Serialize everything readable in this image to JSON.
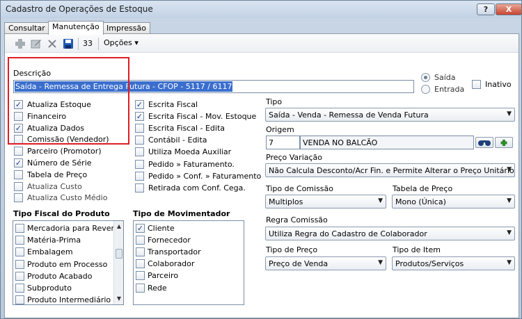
{
  "window": {
    "title": "Cadastro de Operações de Estoque",
    "help": "?",
    "close": "X"
  },
  "tabs": [
    "Consultar",
    "Manutenção",
    "Impressão"
  ],
  "toolbar": {
    "count": "33",
    "options": "Opções ▾"
  },
  "descricao": {
    "label": "Descrição",
    "value": "Saída - Remessa de Entrega Futura - CFOP - 5117 / 6117"
  },
  "direction": {
    "options": [
      "Saída",
      "Entrada"
    ],
    "selected": "Saída"
  },
  "inativo": {
    "label": "Inativo",
    "checked": false
  },
  "flags_col1": [
    {
      "label": "Atualiza  Estoque",
      "checked": true
    },
    {
      "label": "Financeiro",
      "checked": false
    },
    {
      "label": "Atualiza Dados",
      "checked": true
    },
    {
      "label": "Comissão (Vendedor)",
      "checked": false
    },
    {
      "label": "Parceiro (Promotor)",
      "checked": false
    },
    {
      "label": "Número de Série",
      "checked": true
    },
    {
      "label": "Tabela de Preço",
      "checked": false
    },
    {
      "label": "Atualiza Custo",
      "checked": false
    },
    {
      "label": "Atualiza Custo Médio",
      "checked": false
    }
  ],
  "flags_col2": [
    {
      "label": "Escrita Fiscal",
      "checked": true
    },
    {
      "label": "Escrita Fiscal - Mov. Estoque",
      "checked": true
    },
    {
      "label": "Escrita Fiscal - Edita",
      "checked": false
    },
    {
      "label": "Contábil - Edita",
      "checked": false
    },
    {
      "label": "Utiliza Moeda Auxiliar",
      "checked": false
    },
    {
      "label": "Pedido » Faturamento.",
      "checked": false
    },
    {
      "label": "Pedido » Conf. » Faturamento",
      "checked": false
    },
    {
      "label": "Retirada com Conf. Cega.",
      "checked": false
    }
  ],
  "tipo_fiscal": {
    "title": "Tipo Fiscal do Produto",
    "items": [
      "Mercadoria para Reven",
      "Matéria-Prima",
      "Embalagem",
      "Produto em Processo",
      "Produto Acabado",
      "Subproduto",
      "Produto Intermediário"
    ],
    "scroll_up": "▲",
    "scroll_down": "▼"
  },
  "tipo_mov": {
    "title": "Tipo de Movimentador",
    "items": [
      {
        "label": "Cliente",
        "checked": true
      },
      {
        "label": "Fornecedor",
        "checked": false
      },
      {
        "label": "Transportador",
        "checked": false
      },
      {
        "label": "Colaborador",
        "checked": false
      },
      {
        "label": "Parceiro",
        "checked": false
      },
      {
        "label": "Rede",
        "checked": false
      }
    ]
  },
  "right": {
    "tipo": {
      "label": "Tipo",
      "value": "Saída - Venda - Remessa de Venda Futura"
    },
    "origem": {
      "label": "Origem",
      "code": "7",
      "name": "VENDA NO BALCÃO"
    },
    "preco_variacao": {
      "label": "Preço Variação",
      "value": "Não Calcula Desconto/Acr Fin. e Permite Alterar o Preço Unitário"
    },
    "tipo_comissao": {
      "label": "Tipo de Comissão",
      "value": "Multiplos"
    },
    "tabela_preco": {
      "label": "Tabela de Preço",
      "value": "Mono (Única)"
    },
    "regra_comissao": {
      "label": "Regra Comissão",
      "value": "Utiliza Regra do Cadastro de Colaborador"
    },
    "tipo_preco": {
      "label": "Tipo de Preço",
      "value": "Preço de Venda"
    },
    "tipo_item": {
      "label": "Tipo de Item",
      "value": "Produtos/Serviços"
    }
  },
  "check_mark": "✓",
  "dropdown_arrow": "▼"
}
